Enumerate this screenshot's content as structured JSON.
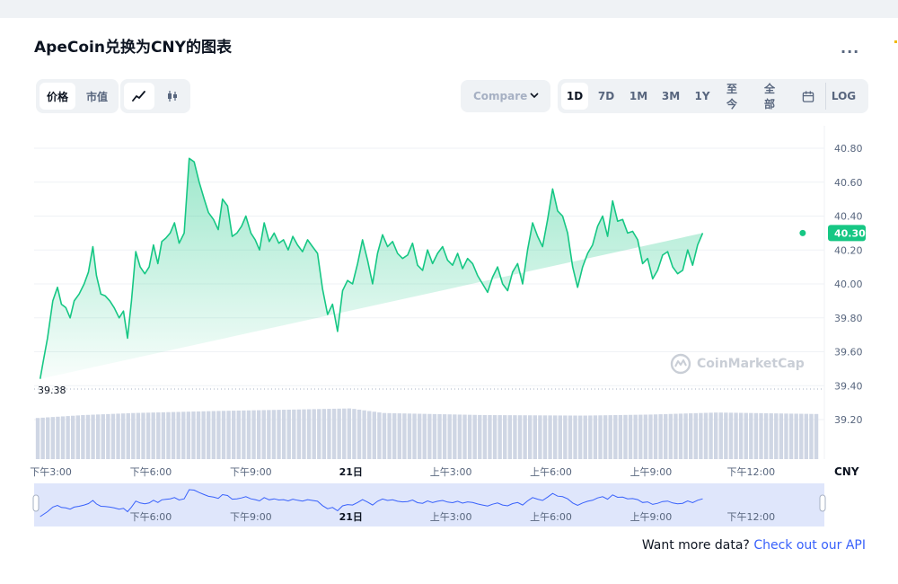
{
  "title": "ApeCoin兑换为CNY的图表",
  "more_label": "...",
  "toggle_tabs": [
    {
      "label": "价格",
      "active": true
    },
    {
      "label": "市值",
      "active": false
    }
  ],
  "chart_type_buttons": [
    {
      "icon": "line-chart-icon",
      "active": true
    },
    {
      "icon": "candlestick-icon",
      "active": false
    }
  ],
  "compare": {
    "label": "Compare"
  },
  "ranges": [
    {
      "label": "1D",
      "active": true
    },
    {
      "label": "7D",
      "active": false
    },
    {
      "label": "1M",
      "active": false
    },
    {
      "label": "3M",
      "active": false
    },
    {
      "label": "1Y",
      "active": false
    },
    {
      "label": "至今",
      "active": false
    },
    {
      "label": "全部",
      "active": false
    }
  ],
  "log_label": "LOG",
  "watermark": "CoinMarketCap",
  "footer": {
    "text": "Want more data?",
    "link": "Check out our API"
  },
  "colors": {
    "line": "#16c784",
    "volume": "#cfd6e4",
    "navigator_fill": "#dfe6fb",
    "navigator_line": "#3861fb",
    "link": "#3861fb"
  },
  "chart_data": {
    "type": "area",
    "currency_label": "CNY",
    "y_ticks": [
      "40.80",
      "40.60",
      "40.40",
      "40.20",
      "40.00",
      "39.80",
      "39.60",
      "39.40",
      "39.20"
    ],
    "ylim": [
      39.1,
      40.86
    ],
    "current_price": "40.30",
    "low_marker": "39.38",
    "x_range_hours": [
      14.5,
      38.2
    ],
    "x_ticks": [
      {
        "label": "下午3:00",
        "t": 15,
        "bold": false
      },
      {
        "label": "下午6:00",
        "t": 18,
        "bold": false
      },
      {
        "label": "下午9:00",
        "t": 21,
        "bold": false
      },
      {
        "label": "21日",
        "t": 24,
        "bold": true
      },
      {
        "label": "上午3:00",
        "t": 27,
        "bold": false
      },
      {
        "label": "上午6:00",
        "t": 30,
        "bold": false
      },
      {
        "label": "上午9:00",
        "t": 33,
        "bold": false
      },
      {
        "label": "下午12:00",
        "t": 36,
        "bold": false
      }
    ],
    "navigator_ticks": [
      {
        "label": "下午6:00",
        "t": 18,
        "bold": false
      },
      {
        "label": "下午9:00",
        "t": 21,
        "bold": false
      },
      {
        "label": "21日",
        "t": 24,
        "bold": true
      },
      {
        "label": "上午3:00",
        "t": 27,
        "bold": false
      },
      {
        "label": "上午6:00",
        "t": 30,
        "bold": false
      },
      {
        "label": "上午9:00",
        "t": 33,
        "bold": false
      },
      {
        "label": "下午12:00",
        "t": 36,
        "bold": false
      }
    ],
    "price": {
      "x": [
        14.68,
        14.78,
        14.9,
        15.06,
        15.2,
        15.32,
        15.45,
        15.58,
        15.7,
        15.85,
        16.0,
        16.13,
        16.26,
        16.37,
        16.5,
        16.63,
        16.77,
        16.9,
        17.05,
        17.18,
        17.3,
        17.42,
        17.55,
        17.68,
        17.82,
        17.95,
        18.08,
        18.21,
        18.33,
        18.45,
        18.58,
        18.71,
        18.85,
        19.0,
        19.15,
        19.3,
        19.45,
        19.6,
        19.73,
        19.88,
        20.02,
        20.15,
        20.3,
        20.44,
        20.58,
        20.72,
        20.85,
        21.0,
        21.13,
        21.26,
        21.4,
        21.55,
        21.7,
        21.84,
        21.98,
        22.12,
        22.26,
        22.4,
        22.55,
        22.7,
        22.85,
        23.0,
        23.15,
        23.3,
        23.45,
        23.6,
        23.75,
        23.9,
        24.05,
        24.2,
        24.35,
        24.5,
        24.65,
        24.8,
        24.95,
        25.1,
        25.25,
        25.4,
        25.55,
        25.7,
        25.85,
        26.0,
        26.15,
        26.3,
        26.45,
        26.6,
        26.75,
        26.9,
        27.05,
        27.2,
        27.35,
        27.5,
        27.65,
        27.8,
        27.95,
        28.1,
        28.25,
        28.4,
        28.55,
        28.7,
        28.85,
        29.0,
        29.15,
        29.3,
        29.45,
        29.6,
        29.75,
        29.9,
        30.05,
        30.2,
        30.35,
        30.5,
        30.65,
        30.8,
        30.95,
        31.1,
        31.25,
        31.4,
        31.55,
        31.7,
        31.85,
        32.0,
        32.15,
        32.3,
        32.45,
        32.6,
        32.75,
        32.9,
        33.05,
        33.2,
        33.35,
        33.5,
        33.65,
        33.8,
        33.95,
        34.1,
        34.25,
        34.4,
        34.55,
        34.7,
        34.85,
        35.0,
        35.15,
        35.3,
        35.45,
        35.6,
        35.75,
        35.9,
        36.05,
        36.2,
        36.35,
        36.5,
        36.65,
        36.8,
        36.95,
        37.1,
        37.25,
        37.4,
        37.55
      ],
      "y": [
        39.44,
        39.55,
        39.68,
        39.9,
        39.98,
        39.88,
        39.86,
        39.8,
        39.9,
        39.94,
        40.0,
        40.07,
        40.22,
        40.05,
        39.94,
        39.93,
        39.9,
        39.86,
        39.8,
        39.84,
        39.68,
        39.9,
        40.19,
        40.1,
        40.06,
        40.1,
        40.23,
        40.12,
        40.25,
        40.27,
        40.3,
        40.36,
        40.24,
        40.3,
        40.74,
        40.72,
        40.6,
        40.5,
        40.42,
        40.38,
        40.32,
        40.5,
        40.46,
        40.28,
        40.3,
        40.34,
        40.4,
        40.3,
        40.26,
        40.2,
        40.36,
        40.25,
        40.3,
        40.24,
        40.26,
        40.2,
        40.28,
        40.23,
        40.19,
        40.26,
        40.22,
        40.18,
        39.97,
        39.82,
        39.88,
        39.72,
        39.96,
        40.02,
        40.0,
        40.12,
        40.26,
        40.14,
        40.0,
        40.18,
        40.29,
        40.22,
        40.25,
        40.18,
        40.15,
        40.17,
        40.24,
        40.11,
        40.08,
        40.2,
        40.12,
        40.18,
        40.22,
        40.14,
        40.11,
        40.18,
        40.09,
        40.15,
        40.12,
        40.05,
        40.0,
        39.95,
        40.04,
        40.1,
        40.0,
        39.96,
        40.07,
        40.12,
        40.0,
        40.2,
        40.36,
        40.28,
        40.22,
        40.38,
        40.56,
        40.43,
        40.4,
        40.3,
        40.1,
        39.98,
        40.1,
        40.18,
        40.23,
        40.34,
        40.4,
        40.28,
        40.49,
        40.37,
        40.38,
        40.3,
        40.31,
        40.26,
        40.12,
        40.15,
        40.03,
        40.08,
        40.17,
        40.19,
        40.1,
        40.06,
        40.08,
        40.2,
        40.11,
        40.23,
        40.3
      ]
    },
    "volume": {
      "x_start": 14.55,
      "x_end": 38.05,
      "count": 156,
      "levels": [
        {
          "t": 14.55,
          "v": 0.8
        },
        {
          "t": 16.0,
          "v": 0.86
        },
        {
          "t": 17.5,
          "v": 0.9
        },
        {
          "t": 20.0,
          "v": 0.94
        },
        {
          "t": 22.5,
          "v": 0.97
        },
        {
          "t": 24.0,
          "v": 0.99
        },
        {
          "t": 25.0,
          "v": 0.9
        },
        {
          "t": 28.0,
          "v": 0.86
        },
        {
          "t": 31.0,
          "v": 0.85
        },
        {
          "t": 33.0,
          "v": 0.87
        },
        {
          "t": 35.0,
          "v": 0.91
        },
        {
          "t": 38.05,
          "v": 0.88
        }
      ],
      "max_volume_label": ""
    }
  }
}
